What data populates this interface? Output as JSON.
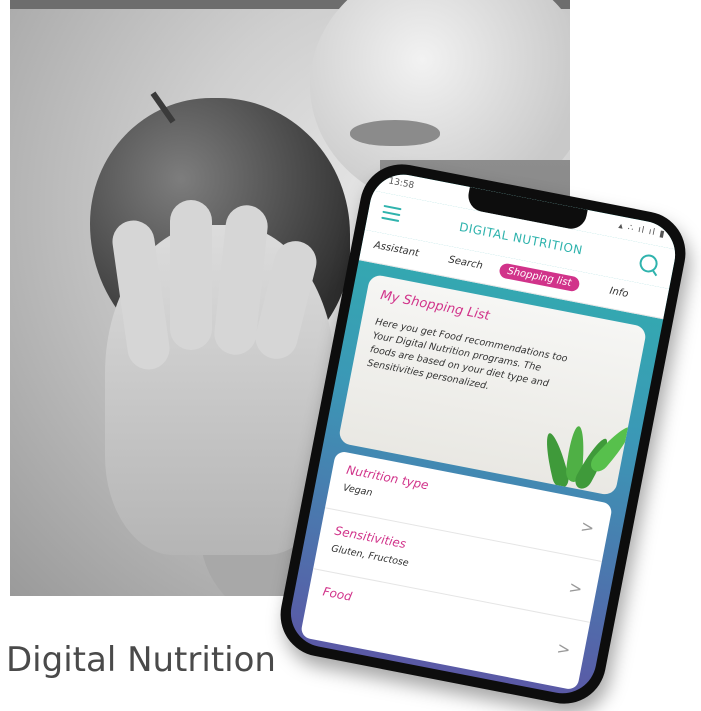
{
  "caption": "Digital Nutrition",
  "phone": {
    "status_time": "13:58",
    "status_icons": "▴ ∴ ıl ıl ▮",
    "app_title": "DIGITAL NUTRITION",
    "tabs": [
      "Assistant",
      "Search",
      "Shopping list",
      "Info"
    ],
    "active_tab": "Shopping list",
    "card": {
      "title": "My Shopping List",
      "text": "Here you get Food recommendations too Your Digital Nutrition programs. The foods are based on your diet type and Sensitivities personalized."
    },
    "list": [
      {
        "label": "Nutrition type",
        "value": "Vegan"
      },
      {
        "label": "Sensitivities",
        "value": "Gluten, Fructose"
      },
      {
        "label": "Food",
        "value": ""
      }
    ],
    "colors": {
      "accent": "#2fb3ad",
      "highlight": "#d1338a"
    }
  }
}
